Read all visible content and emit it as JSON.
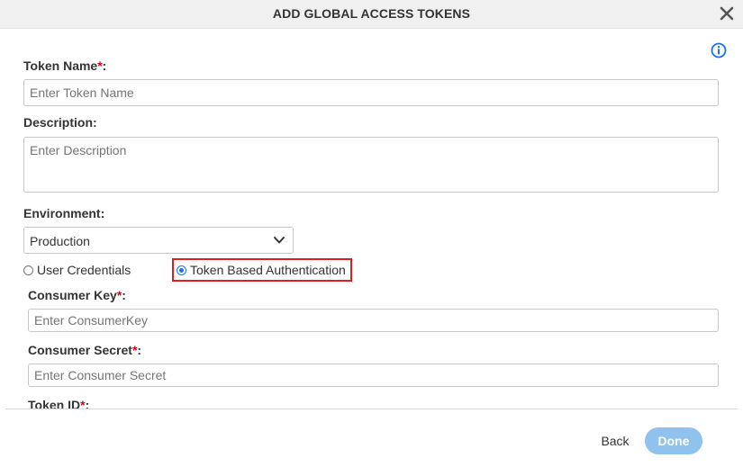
{
  "dialog": {
    "title": "ADD GLOBAL ACCESS TOKENS",
    "close_icon": "close-icon",
    "info_icon": "info-icon"
  },
  "form": {
    "token_name": {
      "label": "Token Name",
      "required_mark": "*",
      "suffix": ":",
      "placeholder": "Enter Token Name",
      "value": ""
    },
    "description": {
      "label": "Description:",
      "placeholder": "Enter Description",
      "value": ""
    },
    "environment": {
      "label": "Environment:",
      "selected": "Production"
    },
    "auth_options": [
      {
        "label": "User Credentials",
        "checked": false
      },
      {
        "label": "Token Based Authentication",
        "checked": true
      }
    ],
    "consumer_key": {
      "label": "Consumer Key",
      "required_mark": "*",
      "suffix": ":",
      "placeholder": "Enter ConsumerKey",
      "value": ""
    },
    "consumer_secret": {
      "label": "Consumer Secret",
      "required_mark": "*",
      "suffix": ":",
      "placeholder": "Enter Consumer Secret",
      "value": ""
    },
    "token_id": {
      "label": "Token ID",
      "required_mark": "*",
      "suffix": ":"
    }
  },
  "footer": {
    "back_label": "Back",
    "done_label": "Done"
  },
  "colors": {
    "required": "#d0021b",
    "accent": "#1a73e8",
    "done_button_disabled": "#8fc3ee",
    "highlight_border": "#e01e1e"
  }
}
